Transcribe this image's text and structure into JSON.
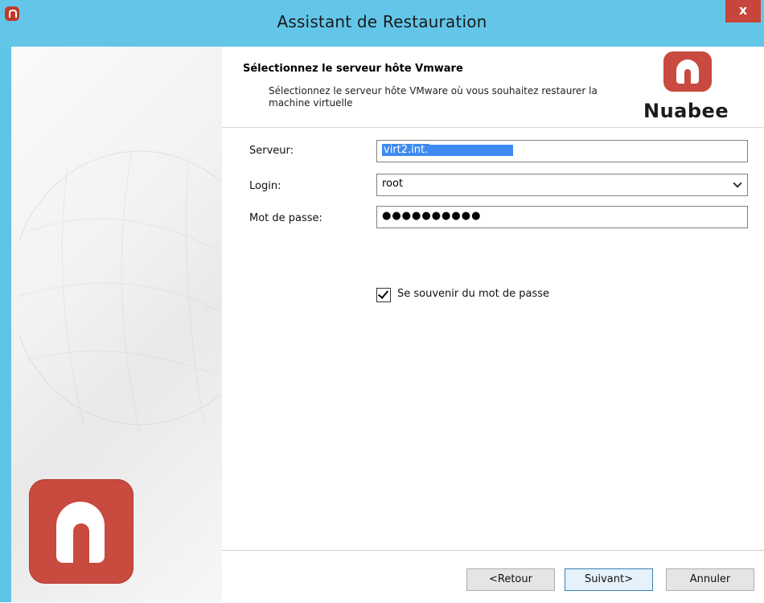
{
  "window": {
    "title": "Assistant de Restauration",
    "close_glyph": "x",
    "accent_color": "#63c6e9",
    "brand_color": "#c94a3e"
  },
  "header": {
    "title": "Sélectionnez le serveur hôte Vmware",
    "subtitle": "Sélectionnez le serveur hôte VMware où vous souhaitez restaurer la machine virtuelle",
    "brand_name": "Nuabee"
  },
  "form": {
    "server_label": "Serveur:",
    "server_value": "virt2.int.",
    "login_label": "Login:",
    "login_value": "root",
    "password_label": "Mot de passe:",
    "password_mask": "●●●●●●●●●●",
    "remember_label": "Se souvenir du mot de passe",
    "remember_checked": true
  },
  "footer": {
    "back_label": "<Retour",
    "next_label": "Suivant>",
    "cancel_label": "Annuler"
  },
  "icons": {
    "app": "nuabee-app-icon",
    "dropdown": "chevron-down-icon",
    "check": "checkmark-icon"
  }
}
